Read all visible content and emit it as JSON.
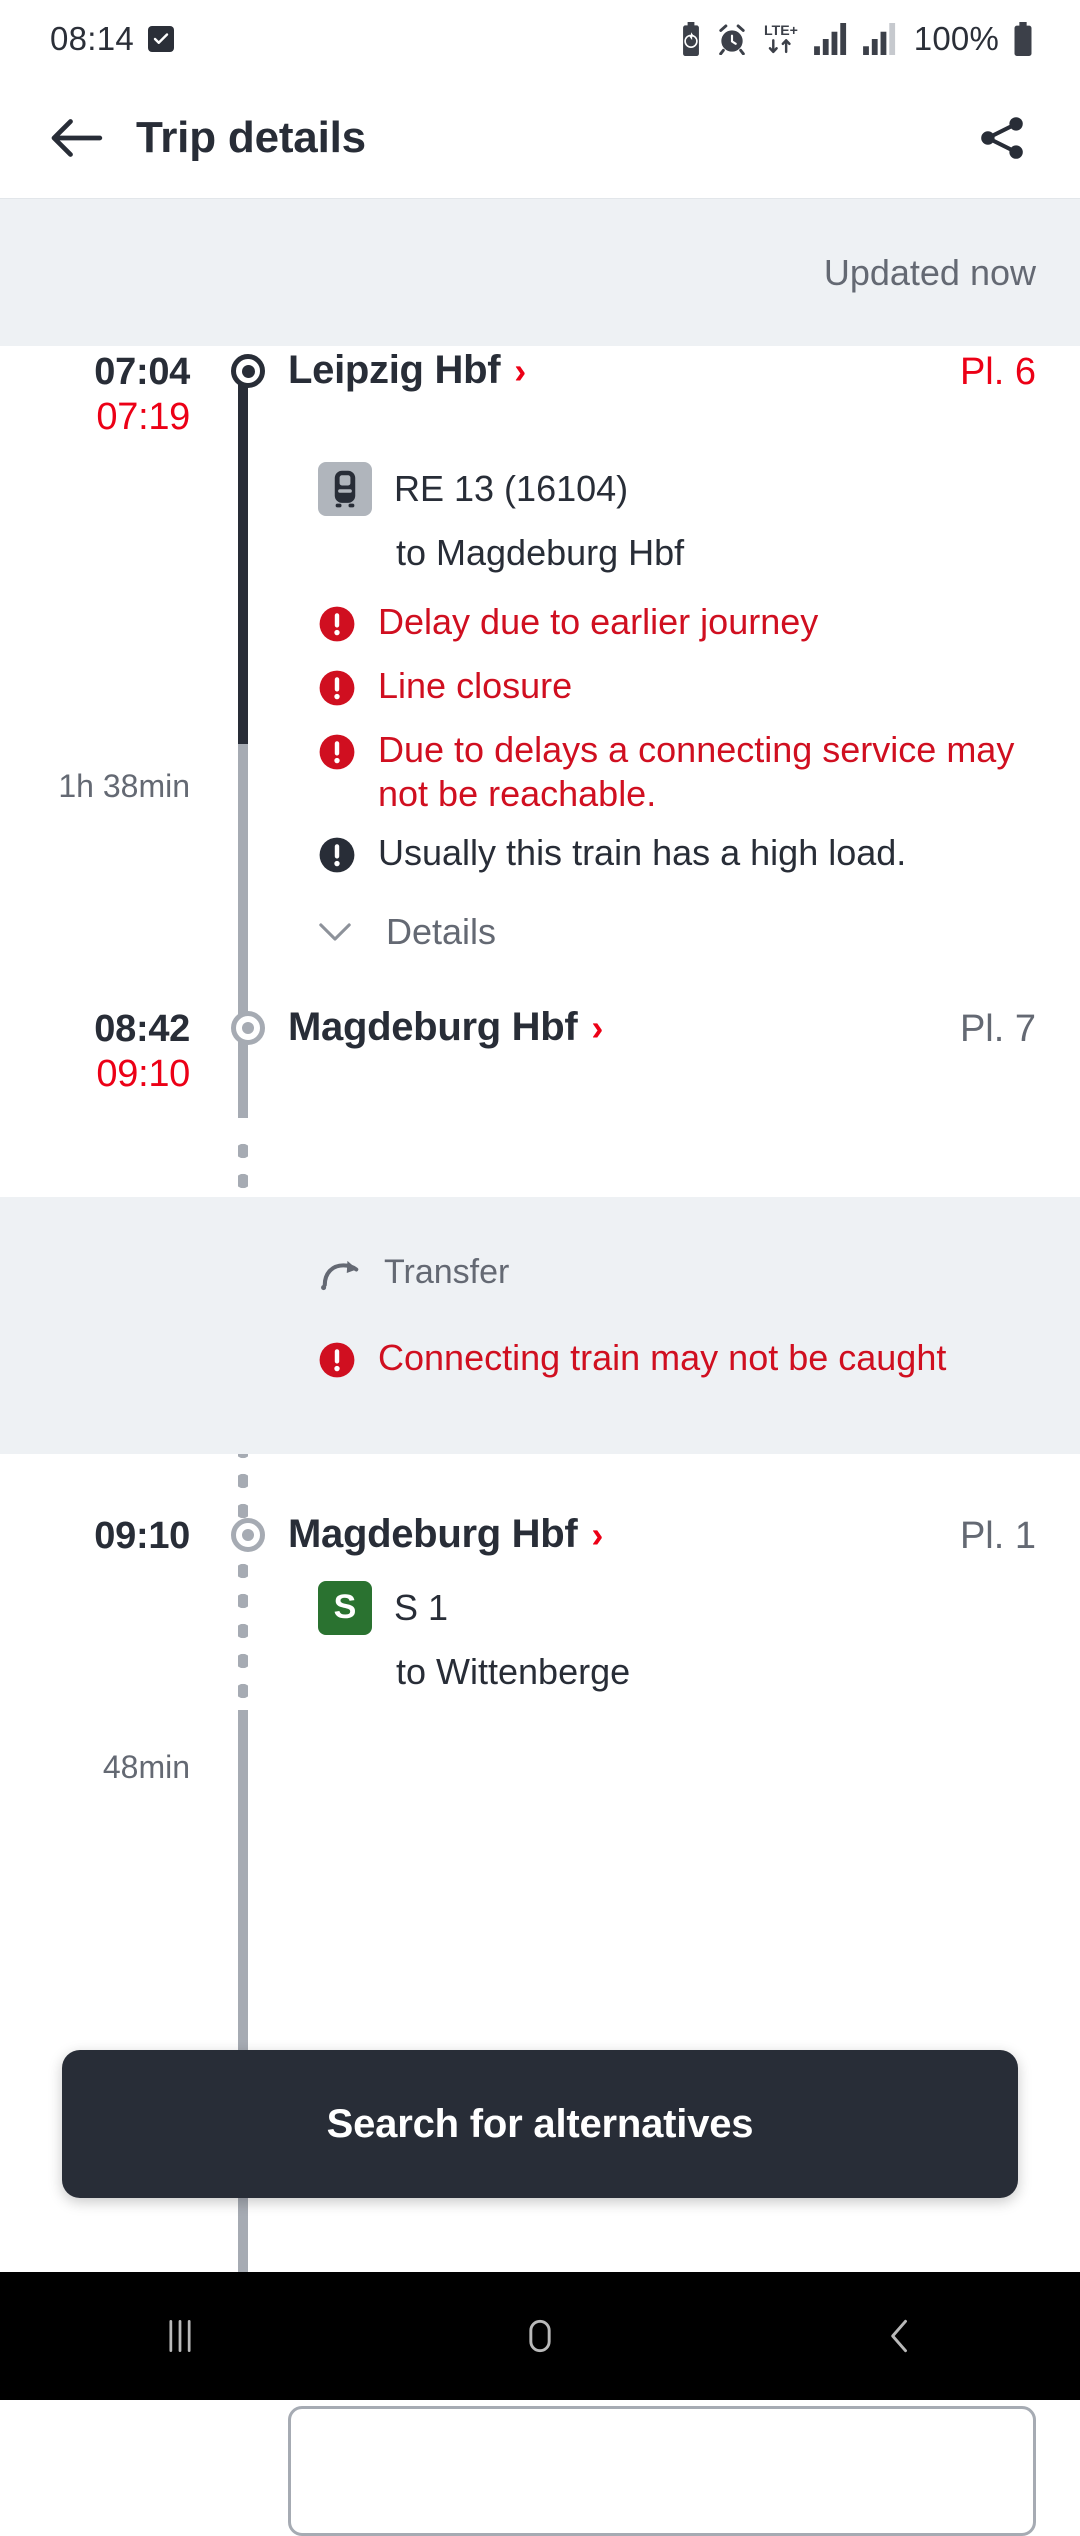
{
  "status_bar": {
    "time": "08:14",
    "battery_percent": "100%",
    "network": "LTE+",
    "icons": [
      "check-badge-icon",
      "battery-saver-icon",
      "alarm-icon",
      "lte-plus-icon",
      "signal-bars-icon",
      "signal-bars-icon",
      "battery-icon"
    ]
  },
  "app_bar": {
    "title": "Trip details",
    "back_icon": "arrow-left-icon",
    "share_icon": "share-icon"
  },
  "banner": {
    "updated_text": "Updated now"
  },
  "legs": [
    {
      "departure": {
        "planned_time": "07:04",
        "actual_time": "07:19",
        "station": "Leipzig Hbf",
        "platform": "Pl. 6",
        "platform_state": "delayed",
        "marker": "dark"
      },
      "duration": "1h 38min",
      "product": {
        "badge_type": "regional-train",
        "badge_text": "",
        "line": "RE 13 (16104)",
        "destination": "to Magdeburg Hbf"
      },
      "alerts": [
        {
          "severity": "red",
          "text": "Delay due to earlier journey"
        },
        {
          "severity": "red",
          "text": "Line closure"
        },
        {
          "severity": "red",
          "text": "Due to delays a connecting service may not be reachable."
        },
        {
          "severity": "dark",
          "text": "Usually this train has a high load."
        }
      ],
      "details_label": "Details",
      "arrival": {
        "planned_time": "08:42",
        "actual_time": "09:10",
        "station": "Magdeburg Hbf",
        "platform": "Pl. 7",
        "platform_state": "normal",
        "marker": "grey"
      }
    },
    {
      "transfer": {
        "label": "Transfer",
        "alerts": [
          {
            "severity": "red",
            "text": "Connecting train may not be caught"
          }
        ]
      }
    },
    {
      "departure": {
        "planned_time": "09:10",
        "actual_time": "",
        "station": "Magdeburg Hbf",
        "platform": "Pl. 1",
        "platform_state": "normal",
        "marker": "grey"
      },
      "duration": "48min",
      "product": {
        "badge_type": "s-bahn",
        "badge_text": "S",
        "line": "S 1",
        "destination": "to Wittenberge"
      }
    }
  ],
  "cta": {
    "label": "Search for alternatives"
  },
  "nav_bar": {
    "recents_icon": "recents-icon",
    "home_icon": "home-icon",
    "back_icon": "back-chevron-icon"
  },
  "colors": {
    "accent_red": "#EC0016",
    "alert_red": "#D00F20",
    "dark": "#282D37",
    "grey": "#646973",
    "rail_grey": "#A6ABB3",
    "banner_bg": "#EEF1F4",
    "sbahn_green": "#2A7230"
  }
}
